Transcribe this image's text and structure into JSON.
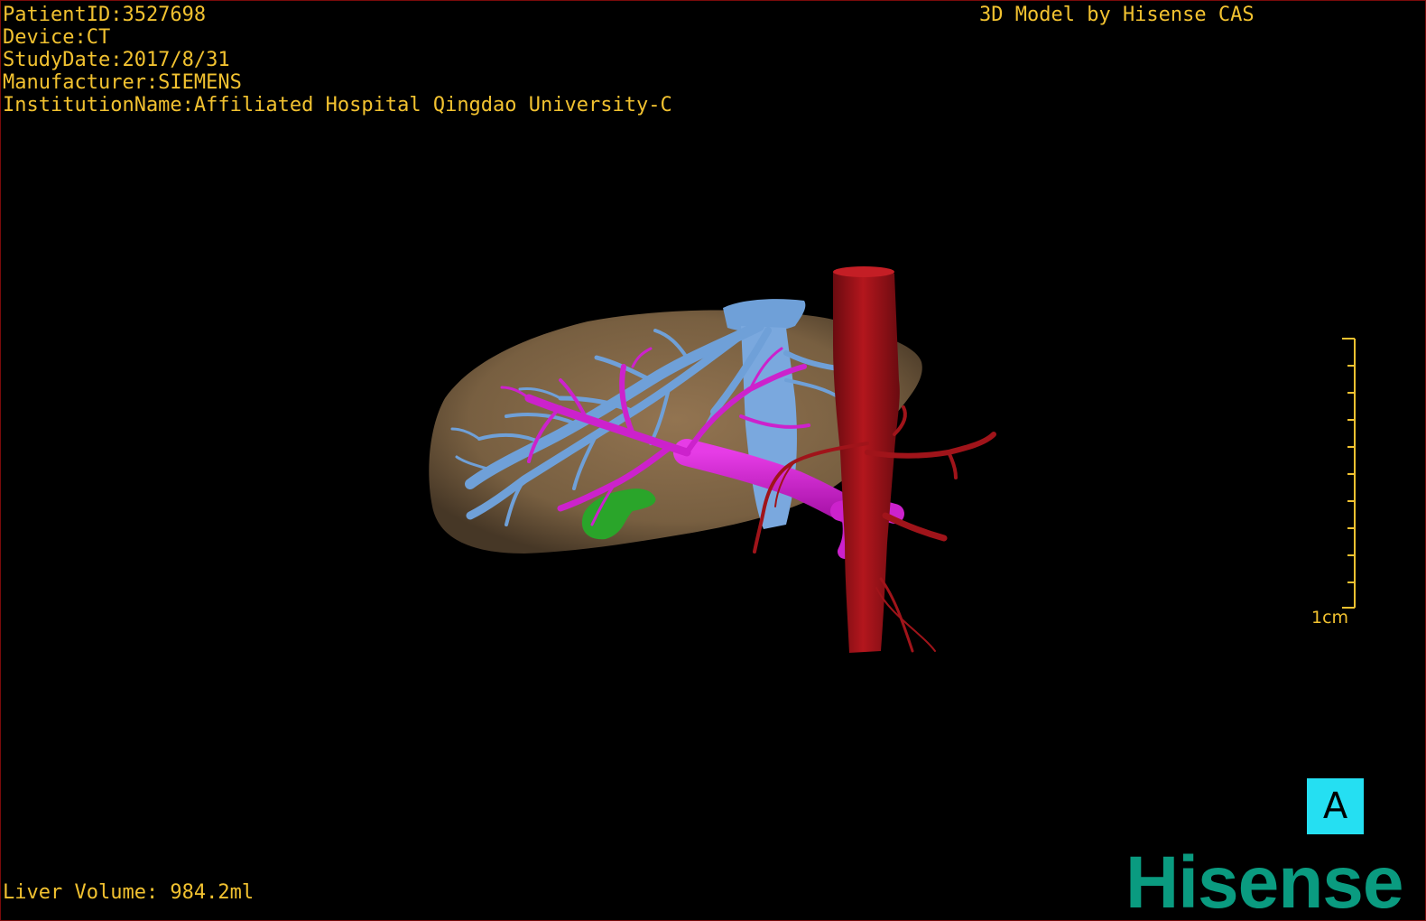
{
  "dicom_info": {
    "patient_id": "PatientID:3527698",
    "device": "Device:CT",
    "study_date": "StudyDate:2017/8/31",
    "manufacturer": "Manufacturer:SIEMENS",
    "institution": "InstitutionName:Affiliated Hospital Qingdao University-C"
  },
  "model_credit": "3D Model by Hisense CAS",
  "liver_volume": "Liver Volume: 984.2ml",
  "scale_bar": {
    "label": "1cm"
  },
  "orientation_marker": {
    "label": "A"
  },
  "brand": {
    "name": "Hisense",
    "color": "#0a9b80"
  },
  "colors": {
    "overlay_text": "#f2c230",
    "liver": "#8a6d4b",
    "hepatic_vein": "#6fa0d8",
    "portal_vein": "#cc22cc",
    "artery": "#a0141a",
    "gallbladder": "#2aa52a",
    "orientation_button": "#25dff2"
  }
}
